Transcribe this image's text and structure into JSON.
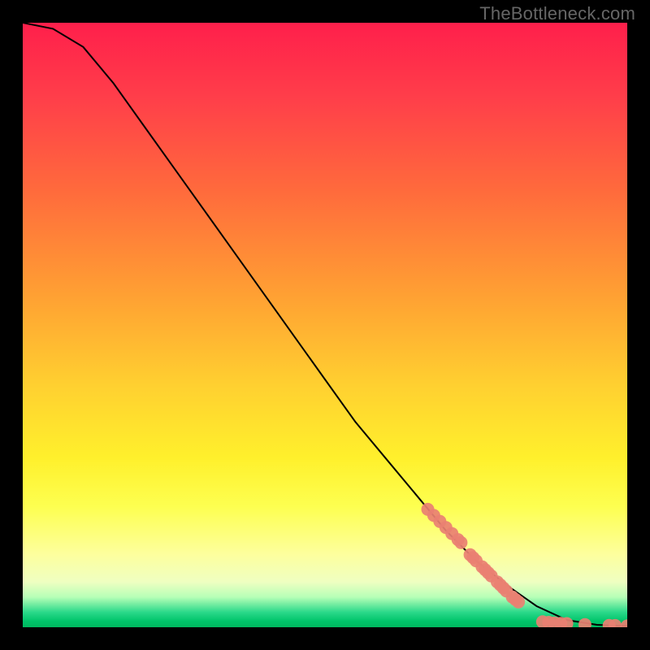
{
  "watermark": "TheBottleneck.com",
  "chart_data": {
    "type": "line",
    "title": "",
    "xlabel": "",
    "ylabel": "",
    "xlim": [
      0,
      100
    ],
    "ylim": [
      0,
      100
    ],
    "curve": {
      "comment": "Monotone descending curve; values are y (0-100) at evenly spaced x (0-100)",
      "x": [
        0,
        5,
        10,
        15,
        20,
        25,
        30,
        35,
        40,
        45,
        50,
        55,
        60,
        65,
        70,
        75,
        80,
        85,
        90,
        95,
        100
      ],
      "y": [
        100,
        99,
        96,
        90,
        83,
        76,
        69,
        62,
        55,
        48,
        41,
        34,
        28,
        22,
        16,
        11,
        7,
        3.5,
        1.2,
        0.4,
        0.2
      ]
    },
    "series": [
      {
        "name": "highlighted-points",
        "comment": "Pink dots overlaid on the tail of the curve",
        "points": [
          [
            67,
            19.5
          ],
          [
            68,
            18.5
          ],
          [
            69,
            17.5
          ],
          [
            70,
            16.5
          ],
          [
            71,
            15.5
          ],
          [
            72,
            14.5
          ],
          [
            72.5,
            14
          ],
          [
            74,
            12
          ],
          [
            74.5,
            11.5
          ],
          [
            75,
            11
          ],
          [
            76,
            10
          ],
          [
            76.5,
            9.5
          ],
          [
            77,
            9
          ],
          [
            77.5,
            8.5
          ],
          [
            78.5,
            7.5
          ],
          [
            79,
            7
          ],
          [
            79.5,
            6.5
          ],
          [
            80,
            6
          ],
          [
            81,
            5
          ],
          [
            81.5,
            4.6
          ],
          [
            82,
            4.2
          ],
          [
            86,
            0.9
          ],
          [
            87,
            0.8
          ],
          [
            88,
            0.7
          ],
          [
            89,
            0.65
          ],
          [
            90,
            0.6
          ],
          [
            93,
            0.45
          ],
          [
            97,
            0.3
          ],
          [
            98,
            0.28
          ],
          [
            100,
            0.22
          ]
        ]
      }
    ],
    "background_gradient": {
      "stops": [
        {
          "pos": 0,
          "color": "#ff1f4b"
        },
        {
          "pos": 45,
          "color": "#ffa033"
        },
        {
          "pos": 80,
          "color": "#fdff50"
        },
        {
          "pos": 97,
          "color": "#2bd98a"
        },
        {
          "pos": 100,
          "color": "#00b85f"
        }
      ]
    }
  }
}
